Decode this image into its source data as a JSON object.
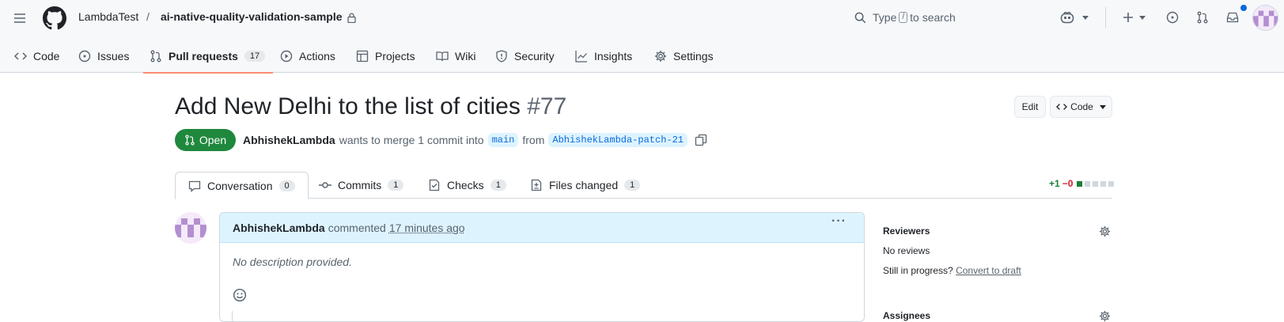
{
  "header": {
    "owner": "LambdaTest",
    "repo": "ai-native-quality-validation-sample",
    "search_prefix": "Type",
    "search_key": "/",
    "search_suffix": "to search"
  },
  "repo_tabs": [
    {
      "label": "Code"
    },
    {
      "label": "Issues"
    },
    {
      "label": "Pull requests",
      "count": "17"
    },
    {
      "label": "Actions"
    },
    {
      "label": "Projects"
    },
    {
      "label": "Wiki"
    },
    {
      "label": "Security"
    },
    {
      "label": "Insights"
    },
    {
      "label": "Settings"
    }
  ],
  "pr": {
    "title": "Add New Delhi to the list of cities",
    "number": "#77",
    "edit_label": "Edit",
    "code_label": "Code",
    "state": "Open",
    "author": "AbhishekLambda",
    "merge_text": "wants to merge 1 commit into",
    "base_branch": "main",
    "from_text": "from",
    "head_branch": "AbhishekLambda-patch-21"
  },
  "pr_tabs": [
    {
      "label": "Conversation",
      "count": "0"
    },
    {
      "label": "Commits",
      "count": "1"
    },
    {
      "label": "Checks",
      "count": "1"
    },
    {
      "label": "Files changed",
      "count": "1"
    }
  ],
  "diffstat": {
    "additions": "+1",
    "deletions": "−0"
  },
  "comment": {
    "author": "AbhishekLambda",
    "action": "commented",
    "time": "17 minutes ago",
    "body": "No description provided."
  },
  "sidebar": {
    "reviewers_title": "Reviewers",
    "reviewers_value": "No reviews",
    "in_progress_text": "Still in progress?",
    "convert_link": "Convert to draft",
    "assignees_title": "Assignees"
  },
  "colors": {
    "open_green": "#1f883d",
    "link_blue": "#0969da",
    "branch_bg": "#ddf4ff",
    "tab_underline": "#fd8c73"
  }
}
